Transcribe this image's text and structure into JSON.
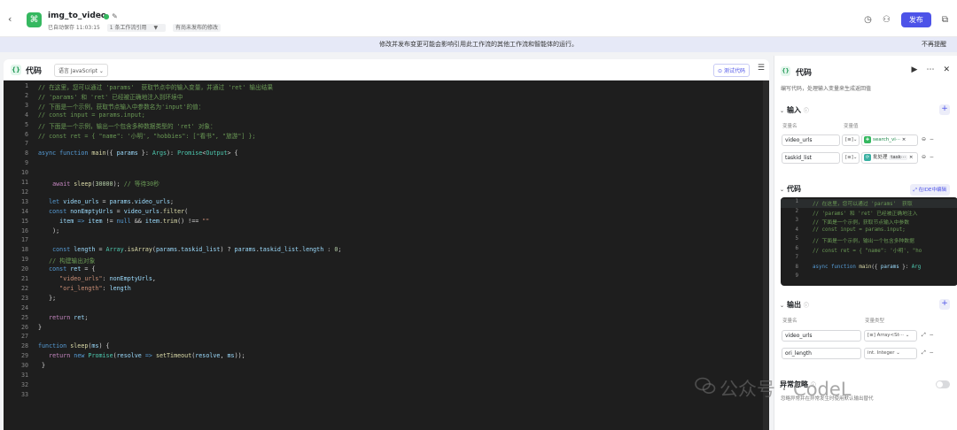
{
  "header": {
    "back_icon": "chevron-left-icon",
    "app_icon": "workflow-icon",
    "title": "img_to_video",
    "autosave": "已自动保存 11:03:15",
    "references": "1 条工作流引用",
    "references_caret": "▼",
    "unpublished": "有尚未发布的修改",
    "publish_label": "发布"
  },
  "notice": {
    "text": "修改并发布变更可能会影响引用此工作流的其他工作流和智能体的运行。",
    "dismiss": "不再提醒"
  },
  "editor": {
    "title": "代码",
    "language": "语言 JavaScript",
    "test_button": "测试代码",
    "line_numbers": [
      "1",
      "2",
      "3",
      "4",
      "5",
      "6",
      "7",
      "8",
      "9",
      "10",
      "11",
      "12",
      "13",
      "14",
      "15",
      "16",
      "17",
      "18",
      "19",
      "20",
      "21",
      "22",
      "23",
      "24",
      "25",
      "26",
      "27",
      "28",
      "29",
      "30",
      "31",
      "32",
      "33"
    ]
  },
  "panel": {
    "title": "代码",
    "description": "编写代码，处理输入变量来生成返回值",
    "input_section": "输入",
    "col_var_name": "变量名",
    "col_var_value": "变量值",
    "inputs": [
      {
        "name": "video_urls",
        "type": "[≡]",
        "ref_node": "search_vi···",
        "ref_icon_color": "#35b860"
      },
      {
        "name": "taskid_list",
        "type": "[≡]",
        "ref_node": "批处理",
        "ref_tag": "task···",
        "ref_icon_color": "#3ab0a2"
      }
    ],
    "code_section": "代码",
    "ide_button": "在IDE中编辑",
    "mini_line_numbers": [
      "1",
      "2",
      "3",
      "4",
      "5",
      "6",
      "7",
      "8",
      "9"
    ],
    "output_section": "输出",
    "col_out_name": "变量名",
    "col_out_type": "变量类型",
    "outputs": [
      {
        "name": "video_urls",
        "type": "Array<St···"
      },
      {
        "name": "ori_length",
        "type": "Integer"
      }
    ],
    "exception_label": "异常忽略",
    "exception_desc": "忽略异常并在异常发生时使用默认输出替代"
  },
  "watermark": {
    "text": "公众号 · CodeL"
  }
}
